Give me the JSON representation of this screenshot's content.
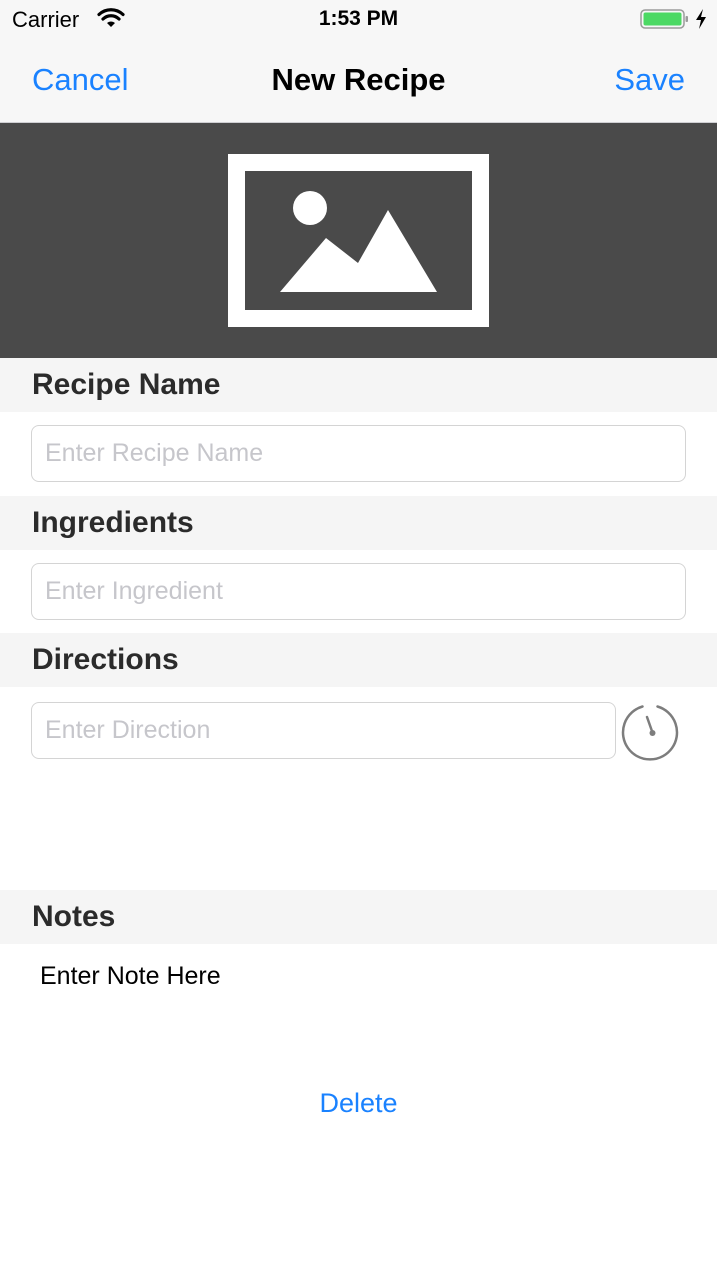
{
  "status_bar": {
    "carrier": "Carrier",
    "time": "1:53 PM",
    "wifi_icon": "wifi-icon",
    "battery_icon": "battery-charging-icon",
    "battery_color": "#4cd964"
  },
  "nav": {
    "cancel_label": "Cancel",
    "title": "New Recipe",
    "save_label": "Save",
    "accent_color": "#1a82ff"
  },
  "photo": {
    "icon": "image-placeholder-icon",
    "background_color": "#4a4a4a"
  },
  "sections": {
    "recipe_name": {
      "header": "Recipe Name",
      "placeholder": "Enter Recipe Name",
      "value": ""
    },
    "ingredients": {
      "header": "Ingredients",
      "placeholder": "Enter Ingredient",
      "value": ""
    },
    "directions": {
      "header": "Directions",
      "placeholder": "Enter Direction",
      "value": "",
      "timer_icon": "timer-icon"
    },
    "notes": {
      "header": "Notes",
      "value": "Enter Note Here"
    }
  },
  "delete_label": "Delete"
}
